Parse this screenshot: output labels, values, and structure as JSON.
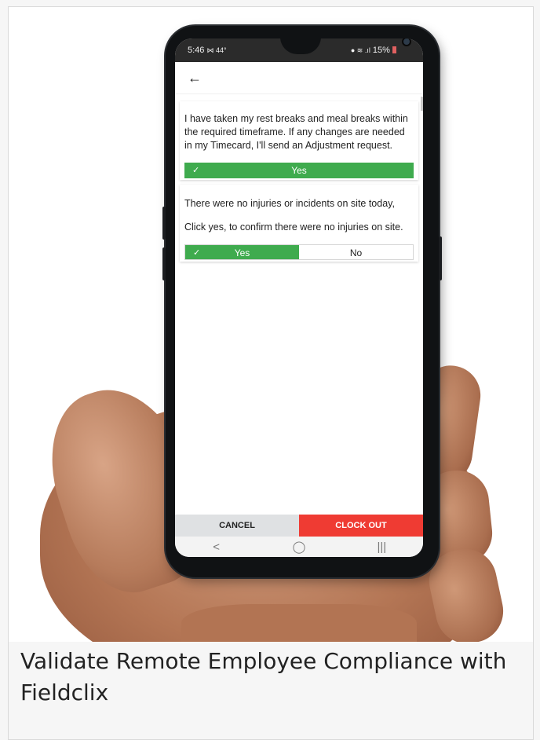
{
  "status_bar": {
    "time": "5:46",
    "left_icons": "⋈ 44°",
    "battery": "15%",
    "right_icons": "● ≋ .ıl"
  },
  "app": {
    "back_icon": "arrow-left-icon",
    "questions": [
      {
        "text": "I have taken my rest breaks and meal breaks within the required timeframe.  If any changes are needed in my Timecard, I'll send an Adjustment request.",
        "answer_label": "Yes",
        "check": "✓"
      },
      {
        "text_line1": "There were no injuries or incidents on site today,",
        "text_line2": "Click yes, to confirm there were no injuries on site.",
        "yes_label": "Yes",
        "no_label": "No",
        "check": "✓",
        "selected": "Yes"
      }
    ],
    "actions": {
      "cancel_label": "CANCEL",
      "clock_out_label": "CLOCK OUT"
    },
    "nav": {
      "back": "<",
      "home": "◯",
      "recents": "|||"
    }
  },
  "caption": "Validate Remote Employee Compliance with Fieldclix",
  "colors": {
    "accent_green": "#3fab4e",
    "clock_out_red": "#ef3b33",
    "cancel_gray": "#dfe1e3"
  }
}
